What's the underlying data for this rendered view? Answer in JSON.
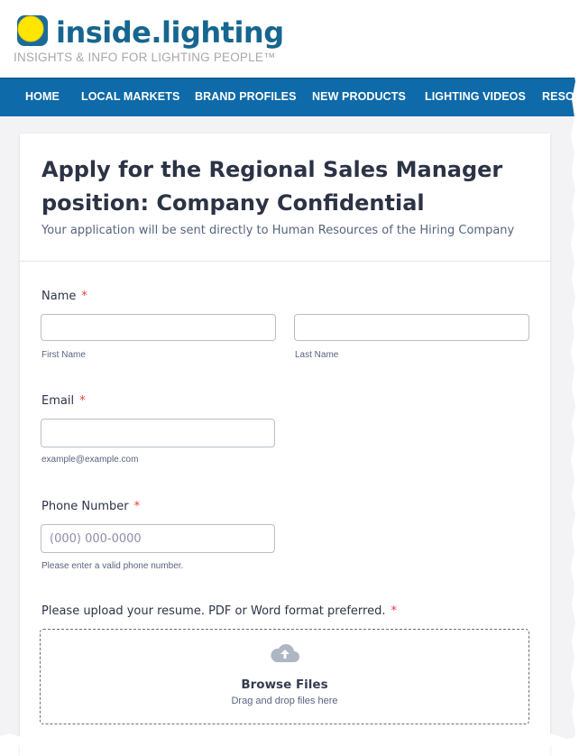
{
  "site": {
    "logo_text": "inside.lighting",
    "tagline": "INSIGHTS & INFO FOR LIGHTING PEOPLE™",
    "logo_icon": "sun-icon",
    "brand_color": "#0e6aa8"
  },
  "nav": {
    "items": [
      {
        "label": "HOME"
      },
      {
        "label": "LOCAL MARKETS"
      },
      {
        "label": "BRAND PROFILES"
      },
      {
        "label": "NEW PRODUCTS"
      },
      {
        "label": "LIGHTING VIDEOS"
      },
      {
        "label": "RESOU"
      }
    ]
  },
  "form": {
    "title": "Apply for the Regional Sales Manager position: Company Confidential",
    "subtitle": "Your application will be sent directly to Human Resources of the Hiring Company",
    "required_mark": "*",
    "name": {
      "label": "Name",
      "first_value": "",
      "last_value": "",
      "first_sublabel": "First Name",
      "last_sublabel": "Last Name"
    },
    "email": {
      "label": "Email",
      "value": "",
      "sublabel": "example@example.com"
    },
    "phone": {
      "label": "Phone Number",
      "value": "",
      "placeholder": "(000) 000-0000",
      "sublabel": "Please enter a valid phone number."
    },
    "resume": {
      "label": "Please upload your resume. PDF or Word format preferred.",
      "browse_label": "Browse Files",
      "drag_text": "Drag and drop files here",
      "icon": "cloud-upload-icon"
    }
  }
}
